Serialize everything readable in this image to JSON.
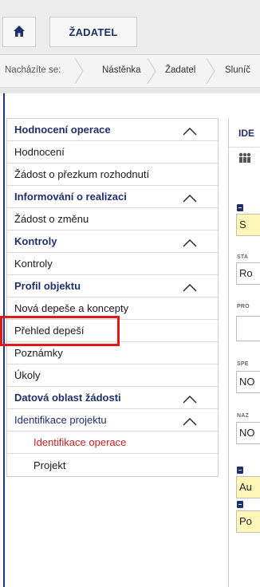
{
  "topbar": {
    "home_icon": "home-icon",
    "zadatel_label": "ŽADATEL"
  },
  "breadcrumb": {
    "lead": "Nacházíte se:",
    "items": [
      "Nástěnka",
      "Žadatel",
      "Sluníč"
    ]
  },
  "sidebar": {
    "items": [
      {
        "label": "Hodnocení operace",
        "kind": "header",
        "chevron": "up"
      },
      {
        "label": "Hodnocení",
        "kind": "sub"
      },
      {
        "label": "Žádost o přezkum rozhodnutí",
        "kind": "sub"
      },
      {
        "label": "Informování o realizaci",
        "kind": "header",
        "chevron": "up"
      },
      {
        "label": "Žádost o změnu",
        "kind": "sub"
      },
      {
        "label": "Kontroly",
        "kind": "header",
        "chevron": "up"
      },
      {
        "label": "Kontroly",
        "kind": "sub"
      },
      {
        "label": "Profil objektu",
        "kind": "header",
        "chevron": "up"
      },
      {
        "label": "Nová depeše a koncepty",
        "kind": "sub"
      },
      {
        "label": "Přehled depeší",
        "kind": "sub",
        "highlighted": true
      },
      {
        "label": "Poznámky",
        "kind": "sub"
      },
      {
        "label": "Úkoly",
        "kind": "sub"
      },
      {
        "label": "Datová oblast žádosti",
        "kind": "header",
        "chevron": "up"
      },
      {
        "label": "Identifikace projektu",
        "kind": "subheader",
        "chevron": "up"
      },
      {
        "label": "Identifikace operace",
        "kind": "subsub",
        "active": true
      },
      {
        "label": "Projekt",
        "kind": "subsub"
      }
    ]
  },
  "right_panel": {
    "header": "IDE",
    "icon": "people-icon",
    "fields": [
      {
        "label": "",
        "value": "S",
        "yellow": true,
        "badge": true
      },
      {
        "label": "STA",
        "value": "Ro",
        "yellow": false,
        "badge": false
      },
      {
        "label": "PRO",
        "value": "",
        "yellow": false,
        "badge": false
      },
      {
        "label": "SPE",
        "value": "NO",
        "yellow": false,
        "badge": false
      },
      {
        "label": "NAZ",
        "value": "NO",
        "yellow": false,
        "badge": false
      },
      {
        "label": "",
        "value": "Au",
        "yellow": true,
        "badge": true
      },
      {
        "label": "",
        "value": "Po",
        "yellow": true,
        "badge": true
      }
    ]
  },
  "colors": {
    "accent_blue": "#1f2f6b",
    "highlight_red": "#e01919",
    "active_red": "#cc1f1f",
    "field_yellow": "#fff7b8"
  }
}
